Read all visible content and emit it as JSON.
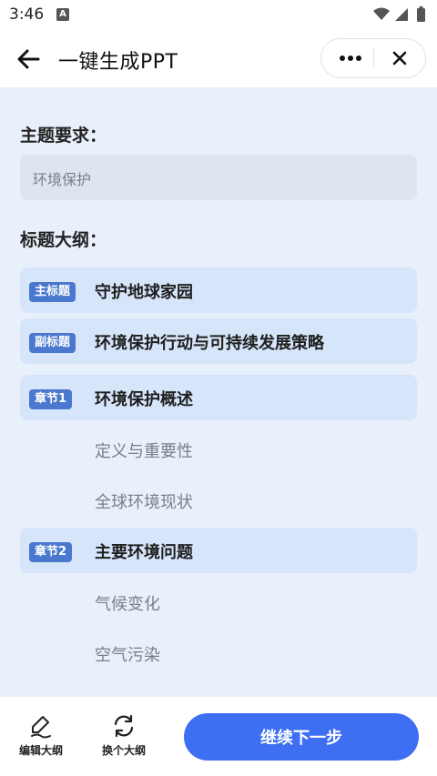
{
  "status": {
    "time": "3:46"
  },
  "header": {
    "title": "一键生成PPT"
  },
  "topic": {
    "label": "主题要求：",
    "value": "环境保护"
  },
  "outline": {
    "label": "标题大纲：",
    "main_title": {
      "badge": "主标题",
      "text": "守护地球家园"
    },
    "sub_title": {
      "badge": "副标题",
      "text": "环境保护行动与可持续发展策略"
    },
    "chapters": [
      {
        "badge": "章节1",
        "text": "环境保护概述",
        "items": [
          "定义与重要性",
          "全球环境现状"
        ]
      },
      {
        "badge": "章节2",
        "text": "主要环境问题",
        "items": [
          "气候变化",
          "空气污染"
        ]
      }
    ]
  },
  "footer": {
    "edit_label": "编辑大纲",
    "change_label": "换个大纲",
    "next_label": "继续下一步"
  },
  "colors": {
    "accent": "#3e6ef2",
    "badge": "#4a78cf",
    "content_bg": "#e8f0fb"
  }
}
